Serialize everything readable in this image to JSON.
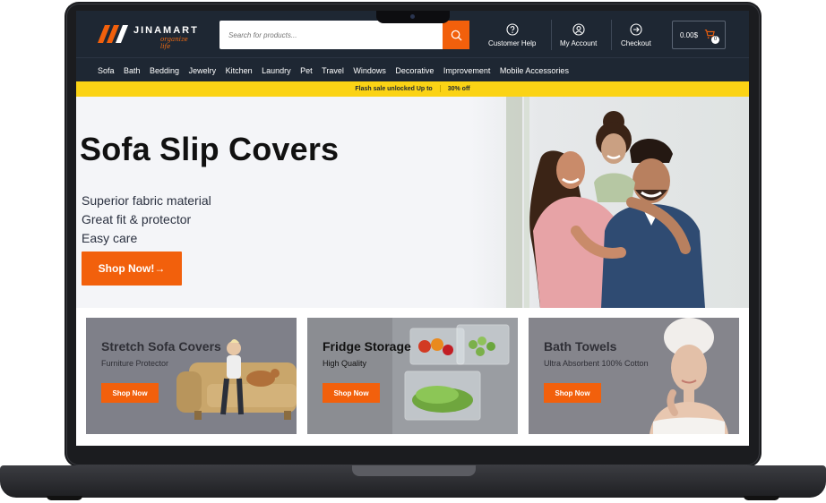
{
  "brand": {
    "name": "JINAMART",
    "tagline": "organize life",
    "colors": {
      "accent": "#f2600c",
      "header": "#1e2733",
      "promo": "#fbd315"
    }
  },
  "search": {
    "placeholder": "Search for products...",
    "icon": "search-icon"
  },
  "header_links": [
    {
      "label": "Customer Help",
      "icon": "help-circle-icon"
    },
    {
      "label": "My Account",
      "icon": "user-icon"
    },
    {
      "label": "Checkout",
      "icon": "arrow-right-circle-icon"
    }
  ],
  "cart": {
    "amount": "0.00$",
    "count": "0",
    "icon": "cart-icon"
  },
  "nav": [
    "Sofa",
    "Bath",
    "Bedding",
    "Jewelry",
    "Kitchen",
    "Laundry",
    "Pet",
    "Travel",
    "Windows",
    "Decorative",
    "Improvement",
    "Mobile Accessories"
  ],
  "promo_bar": {
    "text": "Flash sale unlocked Up to",
    "discount": "30% off"
  },
  "hero": {
    "title": "Sofa Slip Covers",
    "features": [
      "Superior fabric material",
      "Great fit & protector",
      "Easy care"
    ],
    "button": "Shop Now!→"
  },
  "cards": [
    {
      "title": "Stretch Sofa Covers",
      "subtitle": "Furniture Protector",
      "button": "Shop Now"
    },
    {
      "title": "Fridge Storage",
      "subtitle": "High Quality",
      "button": "Shop Now"
    },
    {
      "title": "Bath Towels",
      "subtitle": "Ultra Absorbent 100% Cotton",
      "button": "Shop Now"
    }
  ]
}
